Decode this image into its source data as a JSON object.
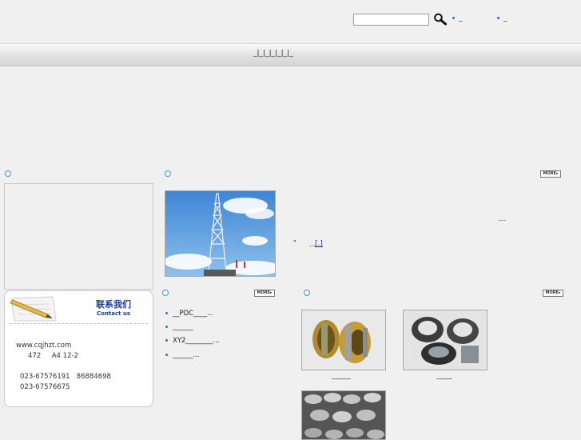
{
  "header": {
    "search": {
      "placeholder": "",
      "value": ""
    },
    "links": [
      "_",
      "_"
    ]
  },
  "nav": {
    "text": "_|_|_|_|_|_|_"
  },
  "about": {
    "more_label": "MORE",
    "text_1": "....",
    "text_2": "\"",
    "text_3": "...",
    "bracket_link": "[.]"
  },
  "contact": {
    "title_cn": "联系我们",
    "title_en": "Contact us",
    "website": "www.cqjhzt.com",
    "address": "472     A4 12-2",
    "phone": "023-67576191   86884698",
    "fax": "023-67576675"
  },
  "product_list": {
    "more_label": "MORE",
    "items": [
      "__PDC____...",
      "______",
      "XY2________...",
      "______..."
    ]
  },
  "products": {
    "more_label": "MORE",
    "captions": [
      "______",
      "_____"
    ]
  },
  "colors": {
    "accent": "#3f8fd8",
    "contact_title": "#1a3c9a",
    "bullet": "#2a6fd0"
  }
}
